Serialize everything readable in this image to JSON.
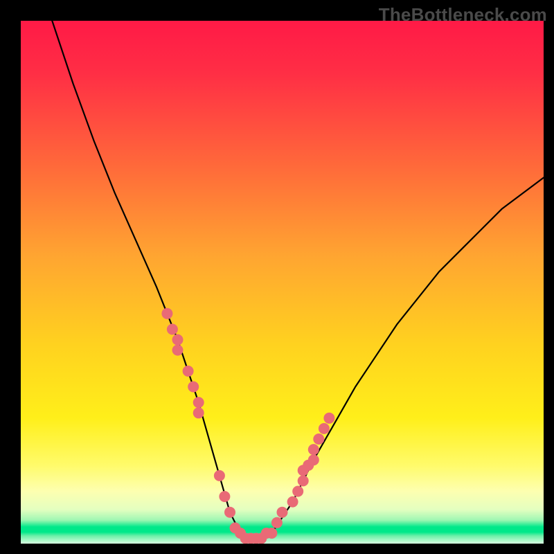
{
  "watermark": "TheBottleneck.com",
  "chart_data": {
    "type": "line",
    "title": "",
    "xlabel": "",
    "ylabel": "",
    "xlim": [
      0,
      100
    ],
    "ylim": [
      0,
      100
    ],
    "grid": false,
    "background_gradient": {
      "top_color": "#ff1a46",
      "mid_color": "#ffe100",
      "bottom_accent": "#00e88a"
    },
    "series": [
      {
        "name": "bottleneck-curve",
        "type": "line",
        "color": "#000000",
        "x": [
          6,
          10,
          14,
          18,
          22,
          26,
          28,
          30,
          32,
          34,
          36,
          38,
          40,
          42,
          44,
          46,
          48,
          52,
          56,
          60,
          64,
          68,
          72,
          76,
          80,
          84,
          88,
          92,
          96,
          100
        ],
        "y": [
          100,
          88,
          77,
          67,
          58,
          49,
          44,
          39,
          33,
          27,
          20,
          13,
          6,
          2,
          1,
          1,
          2,
          8,
          16,
          23,
          30,
          36,
          42,
          47,
          52,
          56,
          60,
          64,
          67,
          70
        ]
      },
      {
        "name": "left-branch-points",
        "type": "scatter",
        "color": "#e96a76",
        "x": [
          28,
          29,
          30,
          30,
          32,
          33,
          34,
          34
        ],
        "y": [
          44,
          41,
          39,
          37,
          33,
          30,
          27,
          25
        ]
      },
      {
        "name": "right-branch-points",
        "type": "scatter",
        "color": "#e96a76",
        "x": [
          52,
          53,
          54,
          54,
          55,
          56,
          56,
          57,
          58,
          59
        ],
        "y": [
          8,
          10,
          12,
          14,
          15,
          16,
          18,
          20,
          22,
          24
        ]
      },
      {
        "name": "valley-points",
        "type": "scatter",
        "color": "#e96a76",
        "x": [
          38,
          39,
          40,
          41,
          42,
          43,
          44,
          45,
          46,
          47,
          48,
          49,
          50
        ],
        "y": [
          13,
          9,
          6,
          3,
          2,
          1,
          1,
          1,
          1,
          2,
          2,
          4,
          6
        ]
      }
    ],
    "annotations": []
  }
}
